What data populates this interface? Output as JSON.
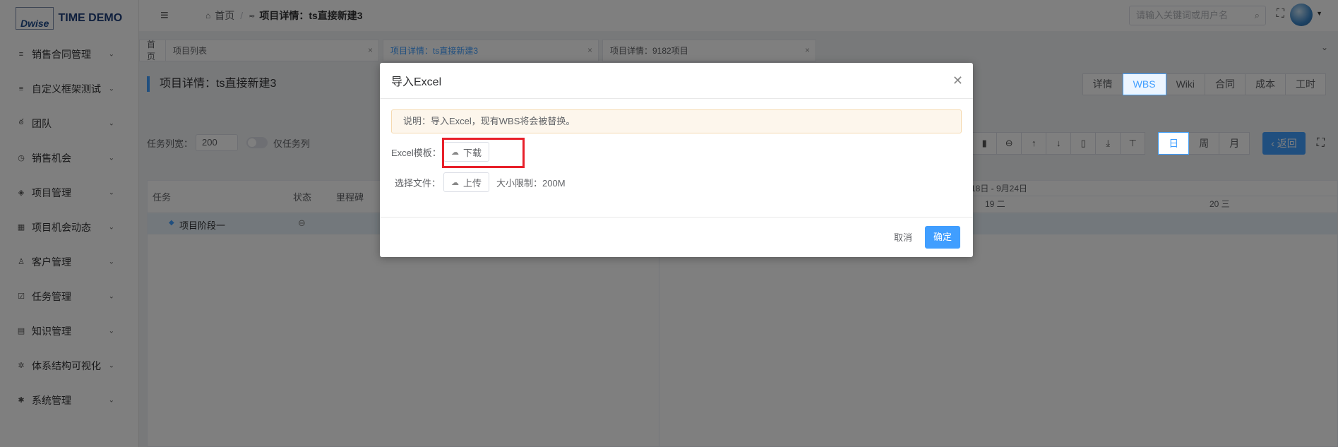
{
  "app": {
    "logo_mark": "Dwise",
    "logo_text": "TIME DEMO"
  },
  "sidebar": {
    "items": [
      {
        "label": "销售合同管理",
        "icon": "list-icon"
      },
      {
        "label": "自定义框架测试",
        "icon": "list-icon"
      },
      {
        "label": "团队",
        "icon": "team-icon"
      },
      {
        "label": "销售机会",
        "icon": "chart-icon"
      },
      {
        "label": "项目管理",
        "icon": "layers-icon"
      },
      {
        "label": "项目机会动态",
        "icon": "calendar-icon"
      },
      {
        "label": "客户管理",
        "icon": "user-icon"
      },
      {
        "label": "任务管理",
        "icon": "check-icon"
      },
      {
        "label": "知识管理",
        "icon": "book-icon"
      },
      {
        "label": "体系结构可视化",
        "icon": "hub-icon"
      },
      {
        "label": "系统管理",
        "icon": "gear-icon"
      }
    ]
  },
  "header": {
    "breadcrumb_home": "首页",
    "breadcrumb_current": "项目详情：ts直接新建3",
    "search_placeholder": "请输入关键词或用户名"
  },
  "tabs": [
    {
      "label": "首页"
    },
    {
      "label": "项目列表"
    },
    {
      "label": "项目详情：ts直接新建3"
    },
    {
      "label": "项目详情：9182项目"
    }
  ],
  "page": {
    "title": "项目详情：ts直接新建3",
    "view_tabs": [
      "详情",
      "WBS",
      "Wiki",
      "合同",
      "成本",
      "工时"
    ],
    "active_view": "WBS"
  },
  "toolbar": {
    "width_label": "任务列宽：",
    "width_value": "200",
    "only_tasks_label": "仅任务列",
    "scale_day": "日",
    "scale_week": "周",
    "scale_month": "月",
    "back_label": "返回"
  },
  "grid": {
    "col_task": "任务",
    "col_status": "状态",
    "col_milestone": "里程碑",
    "row1_task": "项目阶段一",
    "week_range": "18日 - 9月24日",
    "day1": "19 二",
    "day2": "20 三"
  },
  "dialog": {
    "title": "导入Excel",
    "notice": "说明：导入Excel，现有WBS将会被替换。",
    "template_label": "Excel模板：",
    "download_label": "下载",
    "file_label": "选择文件：",
    "upload_label": "上传",
    "size_limit": "大小限制：200M",
    "cancel_label": "取消",
    "ok_label": "确定"
  },
  "colors": {
    "accent": "#409eff",
    "highlight": "#e8202a"
  }
}
